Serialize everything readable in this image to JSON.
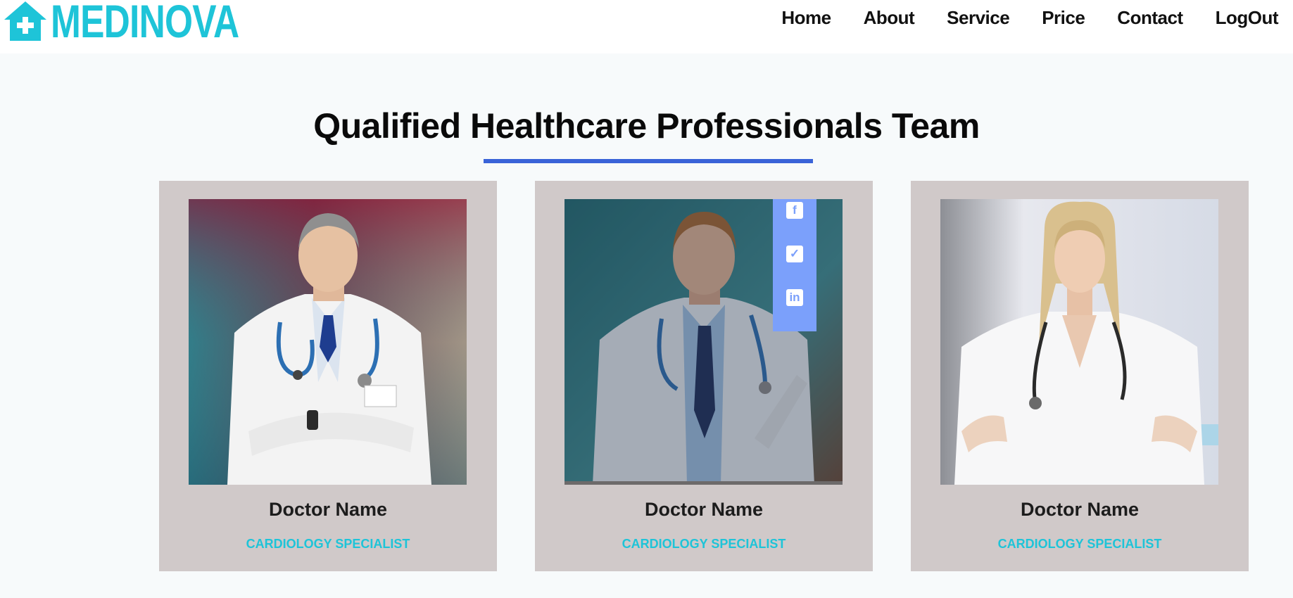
{
  "brand": {
    "name": "MEDINOVA",
    "color": "#1ec4d8"
  },
  "nav": [
    {
      "label": "Home"
    },
    {
      "label": "About"
    },
    {
      "label": "Service"
    },
    {
      "label": "Price"
    },
    {
      "label": "Contact"
    },
    {
      "label": "LogOut"
    }
  ],
  "section": {
    "title": "Qualified Healthcare Professionals Team",
    "underline_color": "#3a63d8"
  },
  "team": [
    {
      "name": "Doctor Name",
      "specialty": "CARDIOLOGY SPECIALIST",
      "photo": "male-doctor-crossed-arms"
    },
    {
      "name": "Doctor Name",
      "specialty": "CARDIOLOGY SPECIALIST",
      "photo": "male-doctor-clipboard"
    },
    {
      "name": "Doctor Name",
      "specialty": "CARDIOLOGY SPECIALIST",
      "photo": "female-doctor"
    }
  ],
  "social": [
    "facebook-icon",
    "twitter-icon",
    "linkedin-icon"
  ],
  "colors": {
    "card_bg": "#d0c9c9",
    "accent": "#1ec4d8",
    "social_bg": "#7ba0fb"
  }
}
